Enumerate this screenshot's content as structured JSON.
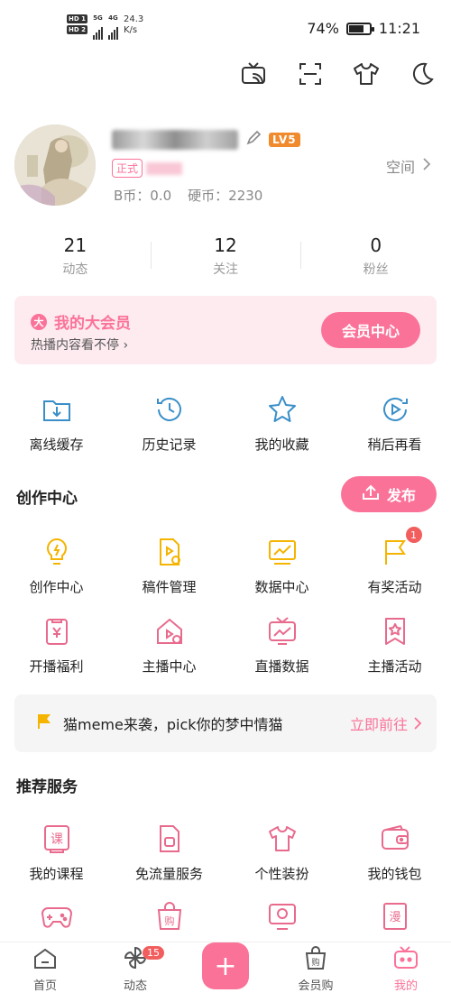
{
  "status_bar": {
    "hd1": "HD 1",
    "hd2": "HD 2",
    "net1": "5G",
    "net2": "4G",
    "speed_value": "24.3",
    "speed_unit": "K/s",
    "battery": "74%",
    "battery_level": 0.74,
    "time": "11:21"
  },
  "top_icons": [
    "tv-cast-icon",
    "scan-icon",
    "tshirt-icon",
    "moon-icon"
  ],
  "profile": {
    "level": "LV5",
    "vip_tag": "正式",
    "b_coin": "B币：0.0",
    "coin": "硬币：2230",
    "space_label": "空间"
  },
  "stats": [
    {
      "num": "21",
      "label": "动态"
    },
    {
      "num": "12",
      "label": "关注"
    },
    {
      "num": "0",
      "label": "粉丝"
    }
  ],
  "vip_card": {
    "badge": "大",
    "title": "我的大会员",
    "subtitle": "热播内容看不停",
    "button": "会员中心"
  },
  "quick_actions": [
    {
      "label": "离线缓存",
      "icon": "download-folder-icon"
    },
    {
      "label": "历史记录",
      "icon": "history-clock-icon"
    },
    {
      "label": "我的收藏",
      "icon": "star-icon"
    },
    {
      "label": "稍后再看",
      "icon": "watch-later-icon"
    }
  ],
  "creation": {
    "title": "创作中心",
    "publish_button": "发布",
    "row1": [
      {
        "label": "创作中心",
        "icon": "bulb-icon",
        "badge": ""
      },
      {
        "label": "稿件管理",
        "icon": "manuscript-icon",
        "badge": ""
      },
      {
        "label": "数据中心",
        "icon": "chart-board-icon",
        "badge": ""
      },
      {
        "label": "有奖活动",
        "icon": "flag-icon",
        "badge": "1"
      }
    ],
    "row2": [
      {
        "label": "开播福利",
        "icon": "live-gift-icon",
        "badge": ""
      },
      {
        "label": "主播中心",
        "icon": "anchor-home-icon",
        "badge": ""
      },
      {
        "label": "直播数据",
        "icon": "live-data-icon",
        "badge": ""
      },
      {
        "label": "主播活动",
        "icon": "anchor-event-icon",
        "badge": ""
      }
    ]
  },
  "banner": {
    "text": "猫meme来袭，pick你的梦中情猫",
    "action": "立即前往"
  },
  "services": {
    "title": "推荐服务",
    "row1": [
      {
        "label": "我的课程",
        "icon": "course-icon"
      },
      {
        "label": "免流量服务",
        "icon": "sim-card-icon"
      },
      {
        "label": "个性装扮",
        "icon": "tshirt-icon"
      },
      {
        "label": "我的钱包",
        "icon": "wallet-icon"
      }
    ],
    "row2": [
      "game-controller-icon",
      "shopping-bag-icon",
      "monitor-icon",
      "comic-icon"
    ]
  },
  "bottom_nav": [
    {
      "label": "首页",
      "icon": "home-icon",
      "badge": ""
    },
    {
      "label": "动态",
      "icon": "pinwheel-icon",
      "badge": "15"
    },
    {
      "label": "",
      "icon": "plus-icon",
      "badge": ""
    },
    {
      "label": "会员购",
      "icon": "bag-icon",
      "badge": ""
    },
    {
      "label": "我的",
      "icon": "tv-mine-icon",
      "badge": ""
    }
  ],
  "colors": {
    "accent": "#fb7299",
    "creation_icon": "#f4b400",
    "service_icon": "#e86b8e",
    "quick_icon": "#3a8fc8"
  }
}
